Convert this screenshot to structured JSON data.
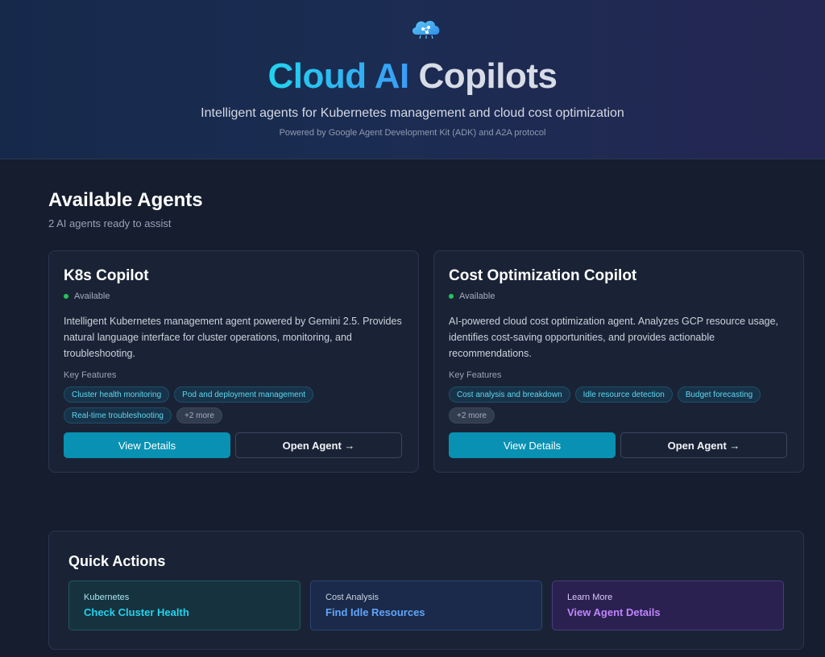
{
  "header": {
    "logo_icon": "cloud-network-icon",
    "title_part1": "Cloud AI",
    "title_part2": "Copilots",
    "subtitle": "Intelligent agents for Kubernetes management and cloud cost optimization",
    "powered_by": "Powered by Google Agent Development Kit (ADK) and A2A protocol"
  },
  "agents_section": {
    "title": "Available Agents",
    "subtitle": "2 AI agents ready to assist"
  },
  "agents": [
    {
      "name": "K8s Copilot",
      "status": "Available",
      "description": "Intelligent Kubernetes management agent powered by Gemini 2.5. Provides natural language interface for cluster operations, monitoring, and troubleshooting.",
      "features_label": "Key Features",
      "features": [
        "Cluster health monitoring",
        "Pod and deployment management",
        "Real-time troubleshooting"
      ],
      "more": "+2 more",
      "view_label": "View Details",
      "open_label": "Open Agent →"
    },
    {
      "name": "Cost Optimization Copilot",
      "status": "Available",
      "description": "AI-powered cloud cost optimization agent. Analyzes GCP resource usage, identifies cost-saving opportunities, and provides actionable recommendations.",
      "features_label": "Key Features",
      "features": [
        "Cost analysis and breakdown",
        "Idle resource detection",
        "Budget forecasting"
      ],
      "more": "+2 more",
      "view_label": "View Details",
      "open_label": "Open Agent →"
    }
  ],
  "quick_actions": {
    "title": "Quick Actions",
    "items": [
      {
        "category": "Kubernetes",
        "action": "Check Cluster Health"
      },
      {
        "category": "Cost Analysis",
        "action": "Find Idle Resources"
      },
      {
        "category": "Learn More",
        "action": "View Agent Details"
      }
    ]
  },
  "colors": {
    "accent_cyan": "#22d3ee",
    "accent_blue": "#60a5fa",
    "accent_purple": "#c084fc",
    "primary_button": "#0891b2",
    "status_available": "#22c55e"
  }
}
